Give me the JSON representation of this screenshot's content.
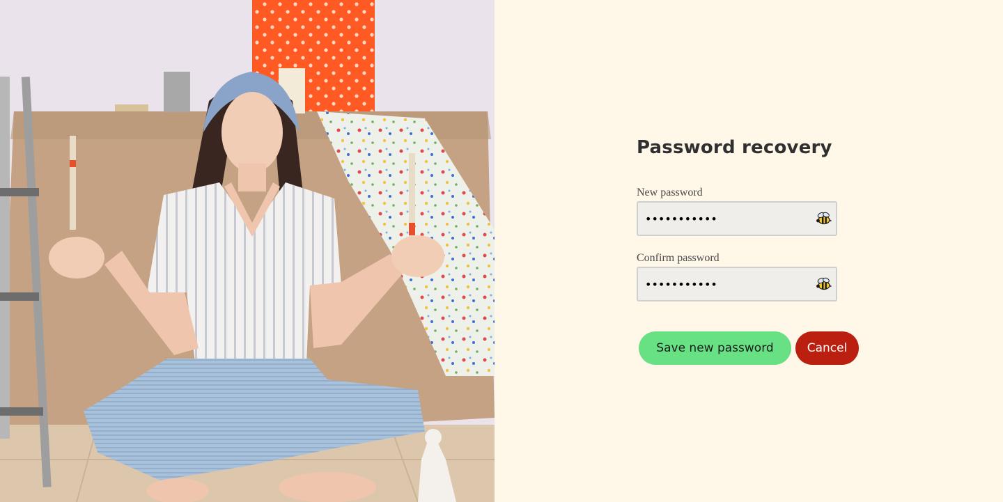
{
  "photo": {
    "alt_icon": "person-meditating-with-paintbrushes-photo"
  },
  "form": {
    "title": "Password recovery",
    "new_password": {
      "label": "New password",
      "value": "•••••••••••",
      "toggle_icon": "bee-icon"
    },
    "confirm_password": {
      "label": "Confirm password",
      "value": "•••••••••••",
      "toggle_icon": "bee-icon"
    },
    "buttons": {
      "save": "Save new password",
      "cancel": "Cancel"
    }
  },
  "colors": {
    "background": "#fff7e8",
    "save_button": "#68e185",
    "cancel_button": "#bb1f0f",
    "title_text": "#2f2f2f"
  }
}
